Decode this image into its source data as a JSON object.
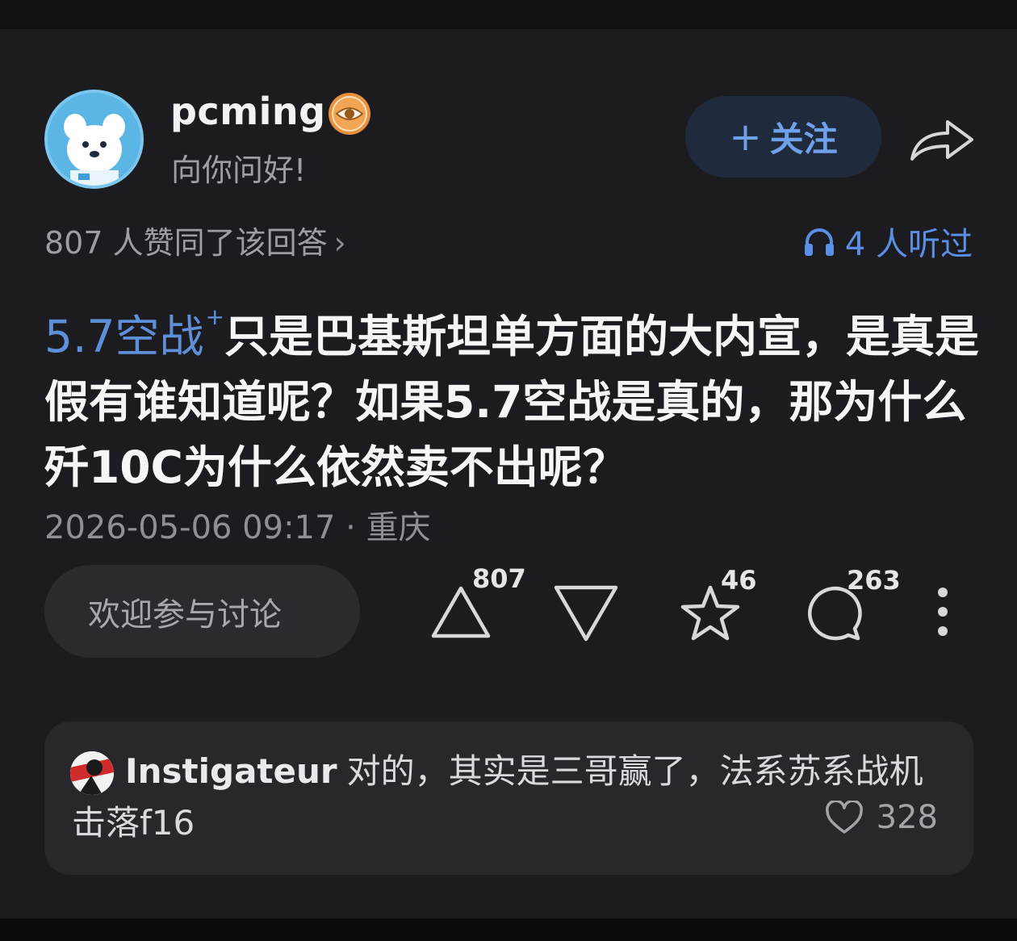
{
  "author": {
    "name": "pcming",
    "subtitle": "向你问好!",
    "badge_icon": "eye-badge-icon",
    "avatar_icon": "dog-avatar-icon"
  },
  "follow_button": {
    "icon": "plus-icon",
    "label": "关注"
  },
  "share_icon": "share-arrow-icon",
  "stats": {
    "agree_text": "807 人赞同了该回答",
    "chevron": "›",
    "listened_text": "4 人听过",
    "listened_icon": "headphones-icon"
  },
  "question": {
    "topic": "5.7空战",
    "topic_mark": "+",
    "text": "只是巴基斯坦单方面的大内宣，是真是假有谁知道呢？如果5.7空战是真的，那为什么歼10C为什么依然卖不出呢？"
  },
  "meta": {
    "datetime": "2026-05-06 09:17",
    "separator": "·",
    "location": "重庆"
  },
  "actions": {
    "discuss_placeholder": "欢迎参与讨论",
    "upvote_count": "807",
    "favorite_count": "46",
    "comment_count": "263"
  },
  "top_comment": {
    "user": "Instigateur",
    "text": "对的，其实是三哥赢了，法系苏系战机击落f16",
    "likes": "328"
  },
  "colors": {
    "background": "#1c1c20",
    "accent_blue": "#5f8fd8",
    "follow_bg": "#1f2b3c",
    "badge_orange": "#e8913c"
  }
}
